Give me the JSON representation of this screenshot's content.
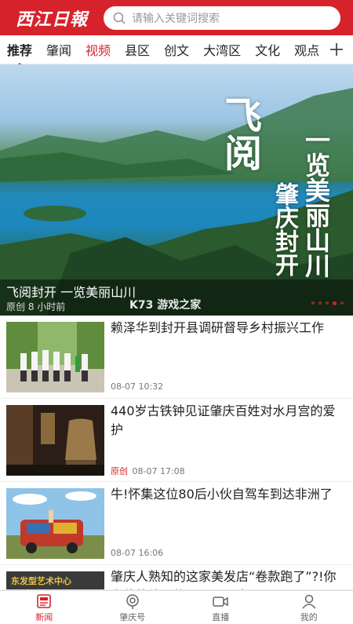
{
  "header": {
    "logo": "西江日報",
    "search_placeholder": "请输入关键词搜索"
  },
  "tabs": [
    {
      "label": "推荐"
    },
    {
      "label": "肇闻"
    },
    {
      "label": "视频"
    },
    {
      "label": "县区"
    },
    {
      "label": "创文"
    },
    {
      "label": "大湾区"
    },
    {
      "label": "文化"
    },
    {
      "label": "观点"
    }
  ],
  "hero": {
    "title": "飞阅封开  一览美丽山川",
    "meta": "原创  8 小时前",
    "calligraphy_left": "飞阅",
    "calligraphy_right_1": "一览美丽山川",
    "calligraphy_right_2": "肇庆封开",
    "watermark": "K73 游戏之家",
    "slide_count": 5,
    "active_slide": 4
  },
  "news": [
    {
      "title": "赖泽华到封开县调研督导乡村振兴工作",
      "original": "",
      "time": "08-07 10:32"
    },
    {
      "title": "440岁古铁钟见证肇庆百姓对水月宫的爱护",
      "original": "原创",
      "time": "08-07 17:08"
    },
    {
      "title": "牛!怀集这位80后小伙自驾车到达非洲了",
      "original": "",
      "time": "08-07 16:06"
    },
    {
      "title": "肇庆人熟知的这家美发店“卷款跑了”?!你充值的钱可能退还不回来",
      "thumb_text": "东发型艺术中心",
      "original": "",
      "time": ""
    }
  ],
  "bottom_nav": [
    {
      "label": "新闻",
      "icon": "news-icon"
    },
    {
      "label": "肇庆号",
      "icon": "location-icon"
    },
    {
      "label": "直播",
      "icon": "video-camera-icon"
    },
    {
      "label": "我的",
      "icon": "user-icon"
    }
  ],
  "colors": {
    "brand": "#d6232b"
  }
}
